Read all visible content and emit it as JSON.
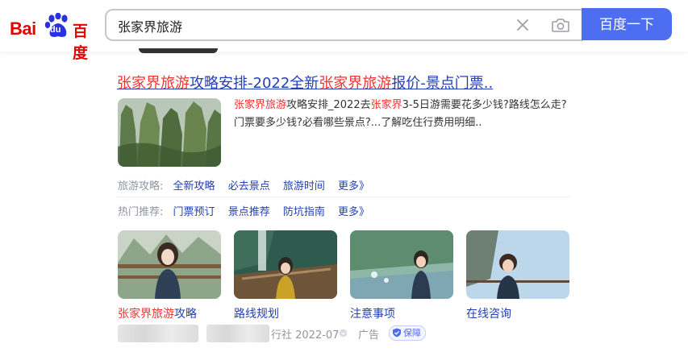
{
  "header": {
    "logo": {
      "bai": "Bai",
      "du": "du",
      "cn": "百度"
    },
    "search": {
      "value": "张家界旅游"
    },
    "search_button": "百度一下"
  },
  "result": {
    "title_parts": [
      "张家界旅游",
      "攻略安排-2022全新",
      "张家界旅游",
      "报价-景点门票.."
    ],
    "desc_parts": [
      "张家界旅游",
      "攻略安排_2022去",
      "张家界",
      "3-5日游需要花多少钱?路线怎么走?门票要多少钱?必看哪些景点?...了解吃住行费用明细.."
    ],
    "row1": {
      "label": "旅游攻略:",
      "links": [
        "全新攻略",
        "必去景点",
        "旅游时间",
        "更多》"
      ]
    },
    "row2": {
      "label": "热门推荐:",
      "links": [
        "门票预订",
        "景点推荐",
        "防坑指南",
        "更多》"
      ]
    },
    "cards": [
      {
        "caption_hl": "张家界旅游",
        "caption": "攻略"
      },
      {
        "caption_hl": "",
        "caption": "路线规划"
      },
      {
        "caption_hl": "",
        "caption": "注意事项"
      },
      {
        "caption_hl": "",
        "caption": "在线咨询"
      }
    ],
    "footer": {
      "source": "行社 2022-07",
      "ad": "广告",
      "badge": "保障"
    }
  },
  "colors": {
    "brand_red": "#e10602",
    "link_blue": "#2440b3",
    "button_blue": "#4e6ef2",
    "highlight": "#f73131"
  }
}
